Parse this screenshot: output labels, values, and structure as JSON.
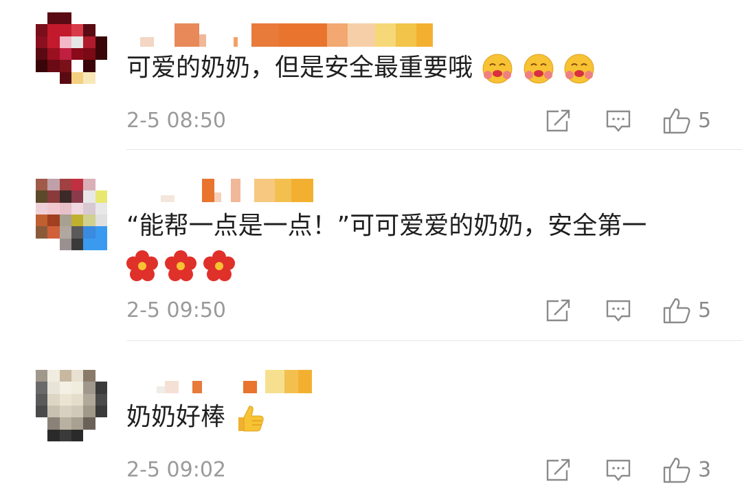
{
  "comments": [
    {
      "text": "可爱的奶奶，但是安全最重要哦",
      "text_emojis": [
        "hugging-face-icon",
        "hugging-face-icon",
        "hugging-face-icon"
      ],
      "date": "2-5 08:50",
      "likes": "5"
    },
    {
      "text": "“能帮一点是一点！”可可爱爱的奶奶，安全第一",
      "text_emojis": [
        "red-flower-icon",
        "red-flower-icon",
        "red-flower-icon"
      ],
      "date": "2-5 09:50",
      "likes": "5"
    },
    {
      "text": "奶奶好棒",
      "text_emojis": [
        "thumbs-up-icon"
      ],
      "date": "2-5 09:02",
      "likes": "3"
    }
  ],
  "icons": {
    "share": "share-icon",
    "reply": "comment-icon",
    "like": "like-icon"
  },
  "colors": {
    "text": "#1f1f1f",
    "meta": "#9a9a9a",
    "icon": "#8a8a8a",
    "divider": "#e6e6e6"
  }
}
